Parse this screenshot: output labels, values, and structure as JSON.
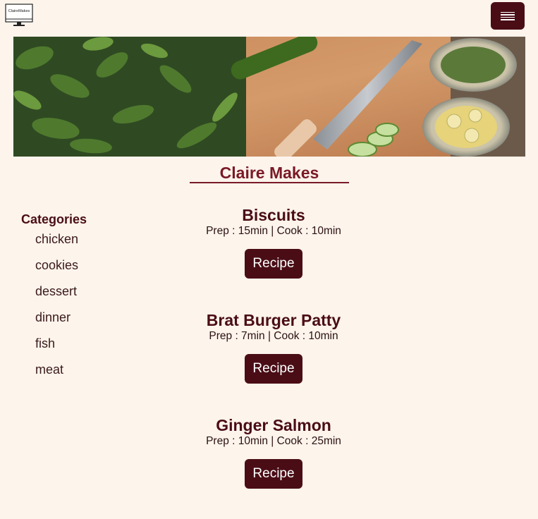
{
  "header": {
    "logo_text": "ClaireMakes",
    "menu_icon": "hamburger-icon"
  },
  "site": {
    "title": "Claire Makes"
  },
  "categories": {
    "heading": "Categories",
    "items": [
      "chicken",
      "cookies",
      "dessert",
      "dinner",
      "fish",
      "meat"
    ]
  },
  "recipes": [
    {
      "title": "Biscuits",
      "meta": "Prep : 15min | Cook : 10min",
      "button": "Recipe"
    },
    {
      "title": "Brat Burger Patty",
      "meta": "Prep : 7min | Cook : 10min",
      "button": "Recipe"
    },
    {
      "title": "Ginger Salmon",
      "meta": "Prep : 10min | Cook : 25min",
      "button": "Recipe"
    }
  ],
  "colors": {
    "background": "#fdf4ec",
    "accent": "#4a0d16",
    "title": "#7a1a26"
  }
}
